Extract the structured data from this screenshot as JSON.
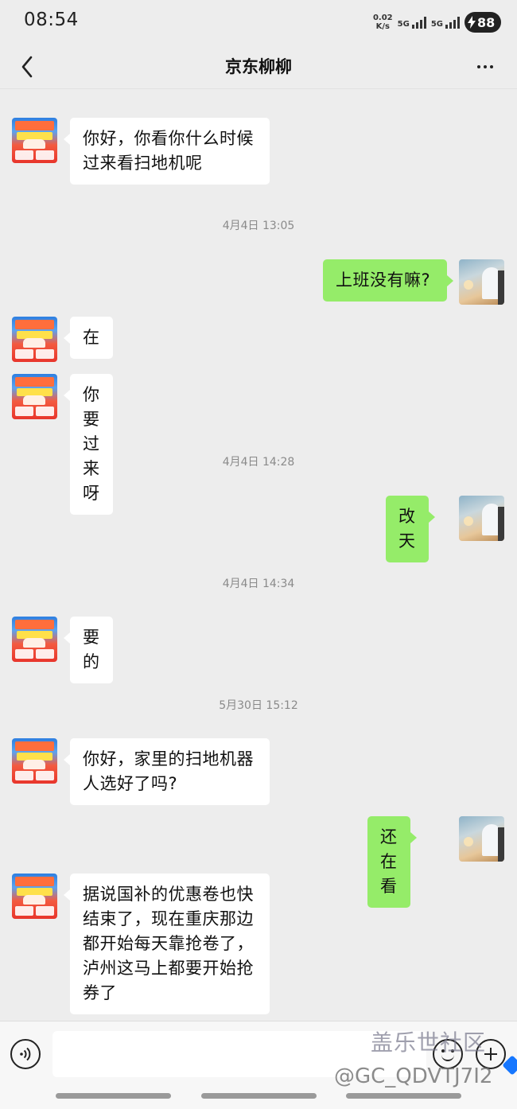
{
  "status_bar": {
    "time": "08:54",
    "net_speed_value": "0.02",
    "net_speed_unit": "K/s",
    "sim1_label": "5G",
    "sim2_label": "5G",
    "battery_level": "88"
  },
  "header": {
    "title": "京东柳柳",
    "back_icon": "chevron-left-icon",
    "more_icon": "more-horizontal-icon"
  },
  "messages": [
    {
      "type": "in",
      "text": "你好，你看你什么时候过来看扫地机呢"
    },
    {
      "type": "time",
      "text": "4月4日 13:05"
    },
    {
      "type": "out",
      "text": "上班没有嘛?"
    },
    {
      "type": "in",
      "text": "在"
    },
    {
      "type": "in",
      "text": "你要过来呀"
    },
    {
      "type": "time",
      "text": "4月4日 14:28"
    },
    {
      "type": "out",
      "text": "改天"
    },
    {
      "type": "time",
      "text": "4月4日 14:34"
    },
    {
      "type": "in",
      "text": "要的"
    },
    {
      "type": "time",
      "text": "5月30日 15:12"
    },
    {
      "type": "in",
      "text": "你好，家里的扫地机器人选好了吗?"
    },
    {
      "type": "out",
      "text": "还在看"
    },
    {
      "type": "in",
      "text": "据说国补的优惠卷也快结束了，现在重庆那边都开始每天靠抢卷了，泸州这马上都要开始抢券了"
    }
  ],
  "input_bar": {
    "placeholder": "",
    "voice_icon": "voice-icon",
    "emoji_icon": "emoji-icon",
    "plus_icon": "plus-icon"
  },
  "watermark": {
    "line1": "盖乐世社区",
    "line2": "@GC_QDVTJ7I2"
  },
  "colors": {
    "background": "#ededed",
    "bubble_in": "#ffffff",
    "bubble_out": "#95ec69",
    "timestamp": "#8a8a8a"
  }
}
